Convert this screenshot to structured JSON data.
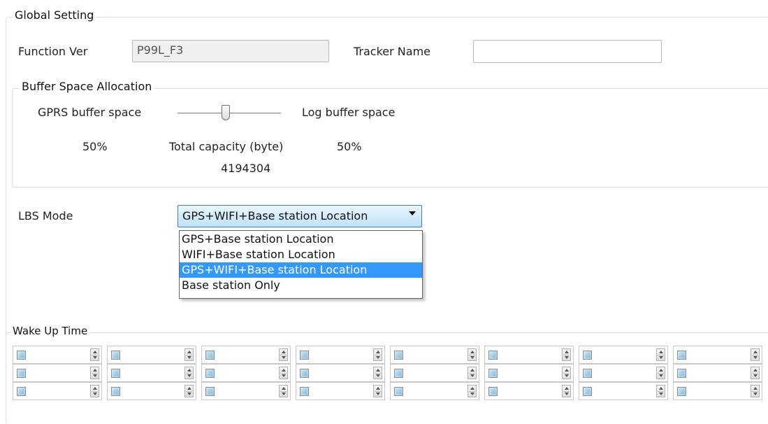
{
  "global": {
    "legend": "Global Setting",
    "function_ver_label": "Function Ver",
    "function_ver_value": "P99L_F3",
    "tracker_name_label": "Tracker Name",
    "tracker_name_value": ""
  },
  "buffer": {
    "legend": "Buffer Space Allocation",
    "gprs_label": "GPRS buffer space",
    "log_label": "Log buffer space",
    "slider_level_percent": 50,
    "gprs_percent": "50%",
    "total_label": "Total capacity (byte)",
    "log_percent": "50%",
    "total_value": "4194304"
  },
  "lbs": {
    "label": "LBS Mode",
    "selected": "GPS+WIFI+Base station Location",
    "options": [
      "GPS+Base station Location",
      "WIFI+Base station Location",
      "GPS+WIFI+Base station Location",
      "Base station Only"
    ],
    "highlighted_index": 2
  },
  "wake": {
    "legend": "Wake Up Time",
    "rows": 3,
    "cols": 8
  },
  "colors": {
    "border": "#d5dfe5",
    "highlight": "#3399ff",
    "combo_border": "#3c7fb1"
  }
}
